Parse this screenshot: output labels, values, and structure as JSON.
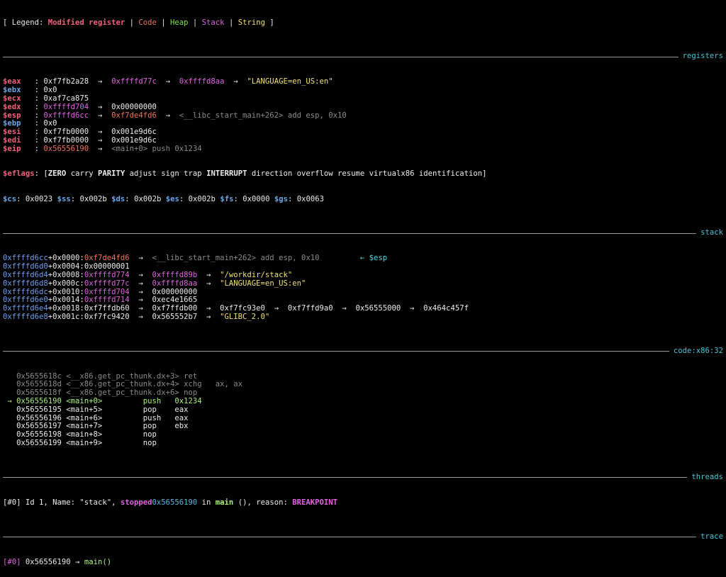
{
  "legend": {
    "prefix": "[ Legend: ",
    "modified": "Modified register",
    "sep1": " | ",
    "code": "Code",
    "sep2": " | ",
    "heap": "Heap",
    "sep3": " | ",
    "stack": "Stack",
    "sep4": " | ",
    "string": "String",
    "suffix": " ]"
  },
  "sections": {
    "registers": "registers",
    "stack": "stack",
    "code": "code:x86:32",
    "threads": "threads",
    "trace": "trace"
  },
  "registers": [
    {
      "name": "$eax",
      "v1": "0xf7fb2a28",
      "v2": "0xffffd77c",
      "v3": "0xffffd8aa",
      "v4": "\"LANGUAGE=en_US:en\""
    },
    {
      "name": "$ebx",
      "v1": "0x0"
    },
    {
      "name": "$ecx",
      "v1": "0xaf7ca875"
    },
    {
      "name": "$edx",
      "v1": "0xffffd704",
      "v2": "0x00000000"
    },
    {
      "name": "$esp",
      "v1": "0xffffd6cc",
      "v2": "0xf7de4fd6",
      "v3": "<__libc_start_main+262> add esp, 0x10"
    },
    {
      "name": "$ebp",
      "v1": "0x0"
    },
    {
      "name": "$esi",
      "v1": "0xf7fb0000",
      "v2": "0x001e9d6c"
    },
    {
      "name": "$edi",
      "v1": "0xf7fb0000",
      "v2": "0x001e9d6c"
    },
    {
      "name": "$eip",
      "v1": "0x56556190",
      "v2": "<main+0> push 0x1234"
    }
  ],
  "eflags": {
    "label": "$eflags",
    "text": ": [ZERO carry PARITY adjust sign trap INTERRUPT direction overflow resume virtualx86 identification]"
  },
  "segments": [
    {
      "name": "$cs",
      "value": "0x0023"
    },
    {
      "name": "$ss",
      "value": "0x002b"
    },
    {
      "name": "$ds",
      "value": "0x002b"
    },
    {
      "name": "$es",
      "value": "0x002b"
    },
    {
      "name": "$fs",
      "value": "0x0000"
    },
    {
      "name": "$gs",
      "value": "0x0063"
    }
  ],
  "stack": [
    {
      "addr": "0xffffd6cc",
      "off": "+0x0000:",
      "rest": [
        {
          "t": "0xf7de4fd6",
          "c": "orange"
        },
        {
          "t": "  →  ",
          "c": "white"
        },
        {
          "t": "<__libc_start_main+262> add esp, 0x10         ",
          "c": "grey"
        },
        {
          "t": "← $esp",
          "c": "cyanb"
        }
      ]
    },
    {
      "addr": "0xffffd6d0",
      "off": "+0x0004:",
      "rest": [
        {
          "t": "0x00000001",
          "c": "white"
        }
      ]
    },
    {
      "addr": "0xffffd6d4",
      "off": "+0x0008:",
      "rest": [
        {
          "t": "0xffffd774",
          "c": "pink"
        },
        {
          "t": "  →  ",
          "c": "white"
        },
        {
          "t": "0xffffd89b",
          "c": "pink"
        },
        {
          "t": "  →  ",
          "c": "white"
        },
        {
          "t": "\"/workdir/stack\"",
          "c": "yellow"
        }
      ]
    },
    {
      "addr": "0xffffd6d8",
      "off": "+0x000c:",
      "rest": [
        {
          "t": "0xffffd77c",
          "c": "pink"
        },
        {
          "t": "  →  ",
          "c": "white"
        },
        {
          "t": "0xffffd8aa",
          "c": "pink"
        },
        {
          "t": "  →  ",
          "c": "white"
        },
        {
          "t": "\"LANGUAGE=en_US:en\"",
          "c": "yellow"
        }
      ]
    },
    {
      "addr": "0xffffd6dc",
      "off": "+0x0010:",
      "rest": [
        {
          "t": "0xffffd704",
          "c": "pink"
        },
        {
          "t": "  →  ",
          "c": "white"
        },
        {
          "t": "0x00000000",
          "c": "white"
        }
      ]
    },
    {
      "addr": "0xffffd6e0",
      "off": "+0x0014:",
      "rest": [
        {
          "t": "0xffffd714",
          "c": "pink"
        },
        {
          "t": "  →  ",
          "c": "white"
        },
        {
          "t": "0xec4e1665",
          "c": "white"
        }
      ]
    },
    {
      "addr": "0xffffd6e4",
      "off": "+0x0018:",
      "rest": [
        {
          "t": "0xf7ffdb60",
          "c": "white"
        },
        {
          "t": "  →  ",
          "c": "white"
        },
        {
          "t": "0xf7ffdb00",
          "c": "white"
        },
        {
          "t": "  →  ",
          "c": "white"
        },
        {
          "t": "0xf7fc93e0",
          "c": "white"
        },
        {
          "t": "  →  ",
          "c": "white"
        },
        {
          "t": "0xf7ffd9a0",
          "c": "white"
        },
        {
          "t": "  →  ",
          "c": "white"
        },
        {
          "t": "0x56555000",
          "c": "white"
        },
        {
          "t": "  →  ",
          "c": "white"
        },
        {
          "t": "0x464c457f",
          "c": "white"
        }
      ]
    },
    {
      "addr": "0xffffd6e8",
      "off": "+0x001c:",
      "rest": [
        {
          "t": "0xf7fc9420",
          "c": "white"
        },
        {
          "t": "  →  ",
          "c": "white"
        },
        {
          "t": "0x565552b7",
          "c": "white"
        },
        {
          "t": "  →  ",
          "c": "white"
        },
        {
          "t": "\"GLIBC_2.0\"",
          "c": "yellow"
        }
      ]
    }
  ],
  "code": [
    {
      "text": "   0x5655618c <__x86.get_pc_thunk.dx+3> ret",
      "style": "grey"
    },
    {
      "text": "   0x5655618d <__x86.get_pc_thunk.dx+4> xchg   ax, ax",
      "style": "grey"
    },
    {
      "text": "   0x5655618f <__x86.get_pc_thunk.dx+6> nop",
      "style": "grey"
    },
    {
      "text": " → 0x56556190 <main+0>         push   0x1234",
      "style": "cur"
    },
    {
      "text": "   0x56556195 <main+5>         pop    eax",
      "style": "white"
    },
    {
      "text": "   0x56556196 <main+6>         push   eax",
      "style": "white"
    },
    {
      "text": "   0x56556197 <main+7>         pop    ebx",
      "style": "white"
    },
    {
      "text": "   0x56556198 <main+8>         nop",
      "style": "white"
    },
    {
      "text": "   0x56556199 <main+9>         nop",
      "style": "white"
    }
  ],
  "threads": {
    "id": "[#0]",
    "text1": " Id 1, Name: \"stack\", ",
    "stopped": "stopped",
    "addr": "0x56556190",
    "in": " in ",
    "func": "main",
    "text2": " (), reason: ",
    "reason": "BREAKPOINT"
  },
  "trace": {
    "id": "[#0]",
    "addr": " 0x56556190 → ",
    "func": "main()"
  },
  "colors": {
    "section_name": "#46c3d6",
    "modified_register": "#f2607a",
    "code": "#f0715a",
    "heap": "#7ee04d",
    "stack": "#e061e0",
    "string": "#f0e070"
  }
}
